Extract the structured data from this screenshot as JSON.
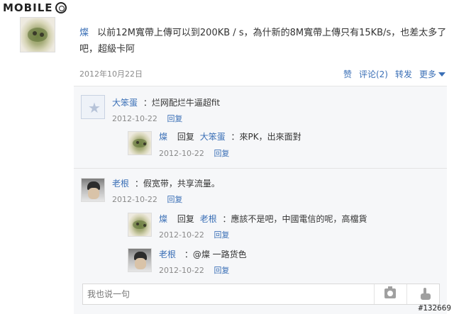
{
  "site": {
    "logo_text": "MOBILE"
  },
  "post": {
    "author": "燦",
    "text": "以前12M寬帶上傳可以到200KB / s，為什新的8M寬帶上傳只有15KB/s，也差太多了吧，超級卡阿",
    "date": "2012年10月22日",
    "actions": {
      "like": "赞",
      "comment": "评论(2)",
      "repost": "转发",
      "more": "更多"
    }
  },
  "comments": [
    {
      "author": "大笨蛋",
      "text": "：烂网配烂牛逼超fit",
      "date": "2012-10-22",
      "reply": "回复"
    },
    {
      "author": "燦",
      "reply_word": "回复",
      "to": "大笨蛋",
      "text": "：來PK，出來面對",
      "date": "2012-10-22",
      "reply": "回复"
    },
    {
      "author": "老根",
      "text": "：假宽带，共享流量。",
      "date": "2012-10-22",
      "reply": "回复"
    },
    {
      "author": "燦",
      "reply_word": "回复",
      "to": "老根",
      "text": "：應該不是吧，中國電信的呢，高檔貨",
      "date": "2012-10-22",
      "reply": "回复"
    },
    {
      "author": "老根",
      "text": "：@燦 一路货色",
      "date": "2012-10-22",
      "reply": "回复"
    }
  ],
  "reply_box": {
    "placeholder": "我也说一句"
  },
  "icons": {
    "camera": "camera-icon",
    "hand": "pointing-hand-icon",
    "star": "star-icon",
    "caret": "caret-down-icon"
  },
  "watermark": "#132669",
  "colors": {
    "link": "#3a6fb6",
    "meta": "#8a8a8a",
    "comment_bg": "#f6f7f9"
  }
}
